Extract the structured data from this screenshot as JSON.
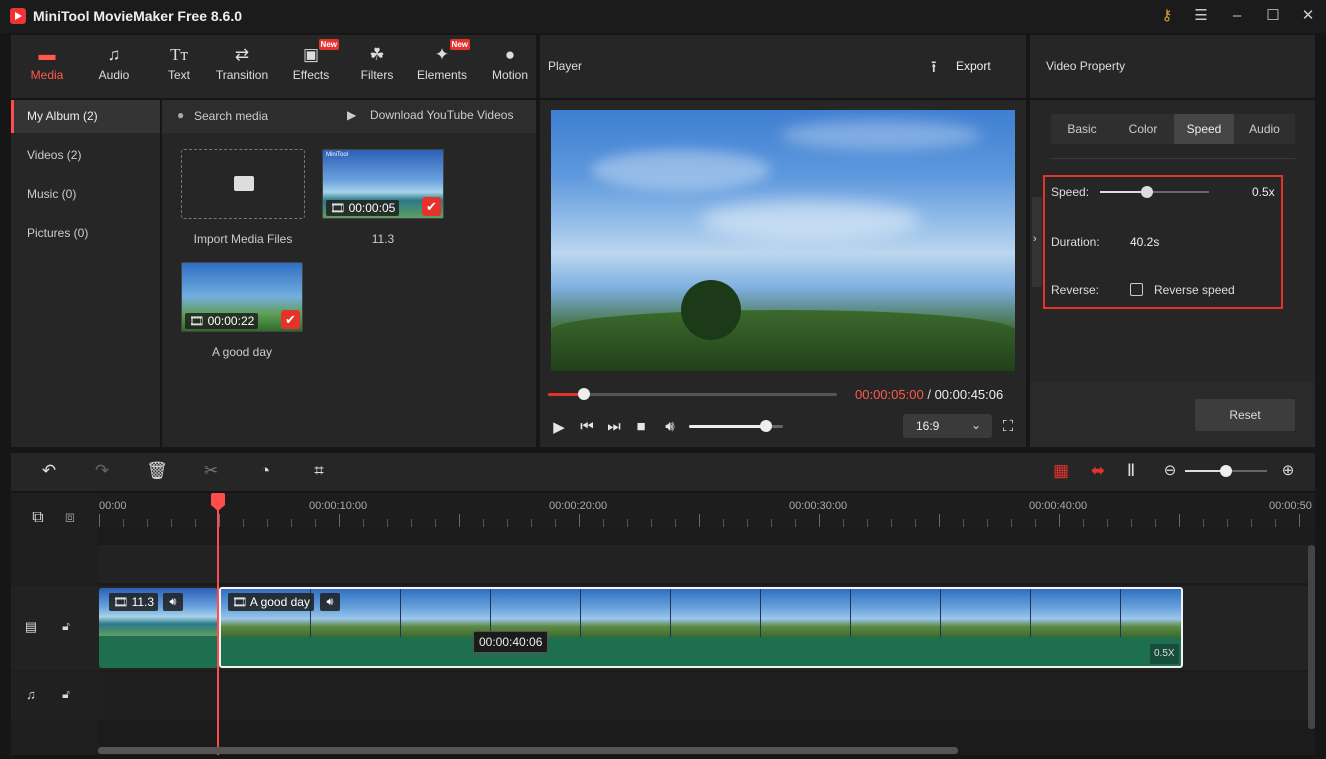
{
  "app": {
    "title": "MiniTool MovieMaker Free 8.6.0",
    "window_controls": [
      "key-icon",
      "menu-icon",
      "minimize-icon",
      "maximize-icon",
      "close-icon"
    ]
  },
  "toolbar": {
    "items": [
      {
        "label": "Media",
        "icon": "media-folder-icon",
        "active": true
      },
      {
        "label": "Audio",
        "icon": "music-note-icon"
      },
      {
        "label": "Text",
        "icon": "text-icon"
      },
      {
        "label": "Transition",
        "icon": "transition-icon"
      },
      {
        "label": "Effects",
        "icon": "effects-icon",
        "badge": "New"
      },
      {
        "label": "Filters",
        "icon": "filters-icon"
      },
      {
        "label": "Elements",
        "icon": "elements-icon",
        "badge": "New"
      },
      {
        "label": "Motion",
        "icon": "motion-icon"
      }
    ]
  },
  "sidebar": {
    "items": [
      {
        "label": "My Album (2)",
        "active": true
      },
      {
        "label": "Videos (2)"
      },
      {
        "label": "Music (0)"
      },
      {
        "label": "Pictures (0)"
      }
    ]
  },
  "media": {
    "search_label": "Search media",
    "download_label": "Download YouTube Videos",
    "import_label": "Import Media Files",
    "items": [
      {
        "name": "11.3",
        "duration": "00:00:05",
        "watermark": "MiniTool"
      },
      {
        "name": "A good day",
        "duration": "00:00:22"
      }
    ]
  },
  "player": {
    "title": "Player",
    "export_label": "Export",
    "current_time": "00:00:05:00",
    "separator": "/",
    "total_time": "00:00:45:06",
    "progress_fraction": 0.125,
    "volume_fraction": 0.82,
    "aspect_ratio": "16:9"
  },
  "property": {
    "title": "Video Property",
    "tabs": [
      {
        "label": "Basic"
      },
      {
        "label": "Color"
      },
      {
        "label": "Speed",
        "active": true
      },
      {
        "label": "Audio"
      }
    ],
    "speed_label": "Speed:",
    "speed_value": "0.5x",
    "speed_fraction": 0.43,
    "duration_label": "Duration:",
    "duration_value": "40.2s",
    "reverse_label": "Reverse:",
    "reverse_checkbox_label": "Reverse speed",
    "reverse_checked": false,
    "reset_label": "Reset"
  },
  "timeline": {
    "zoom_fraction": 0.5,
    "ruler_labels": [
      "00:00",
      "00:00:10:00",
      "00:00:20:00",
      "00:00:30:00",
      "00:00:40:00",
      "00:00:50"
    ],
    "clips": [
      {
        "name": "11.3"
      },
      {
        "name": "A good day",
        "speed_badge": "0.5X"
      }
    ],
    "hover_time": "00:00:40:06"
  },
  "colors": {
    "accent": "#ff4c4c",
    "clip_green": "#1e6e50",
    "highlight_box": "#e4332b"
  }
}
